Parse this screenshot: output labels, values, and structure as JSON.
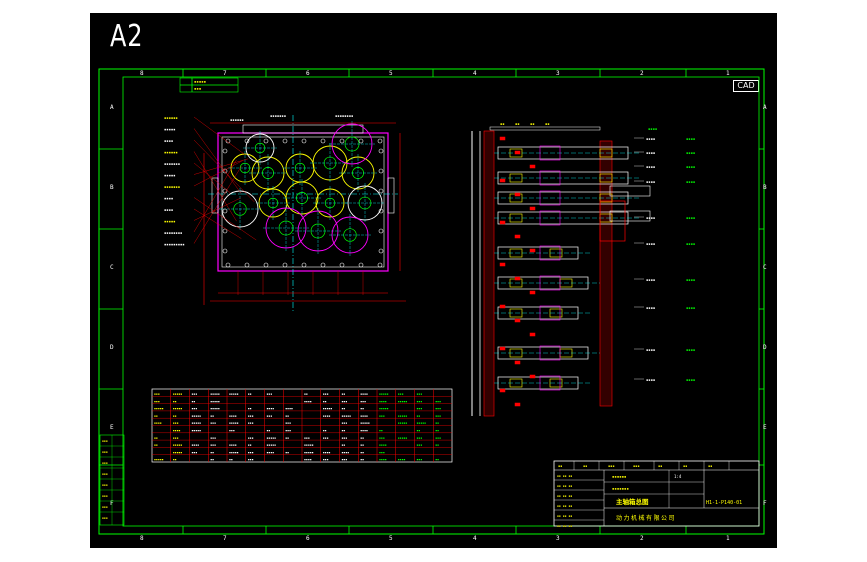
{
  "sheet": {
    "size": "A2",
    "badge": "CAD"
  },
  "grid": {
    "columns": [
      "8",
      "7",
      "6",
      "5",
      "4",
      "3",
      "2",
      "1"
    ],
    "rows": [
      "A",
      "B",
      "C",
      "D",
      "E",
      "F"
    ]
  },
  "colors": {
    "background": "#000000",
    "frame": "#00ff00",
    "text": "#ffffff",
    "dimension": "#ff0000",
    "part": "#ff00ff",
    "label": "#ffff00",
    "centerline": "#00ffff",
    "note": "#00ff00"
  },
  "title_block": {
    "drawing_name": "主轴箱总图",
    "company": "动力机械有限公司",
    "drawing_number": "H1-1-P140-01",
    "scale": "1:4"
  }
}
